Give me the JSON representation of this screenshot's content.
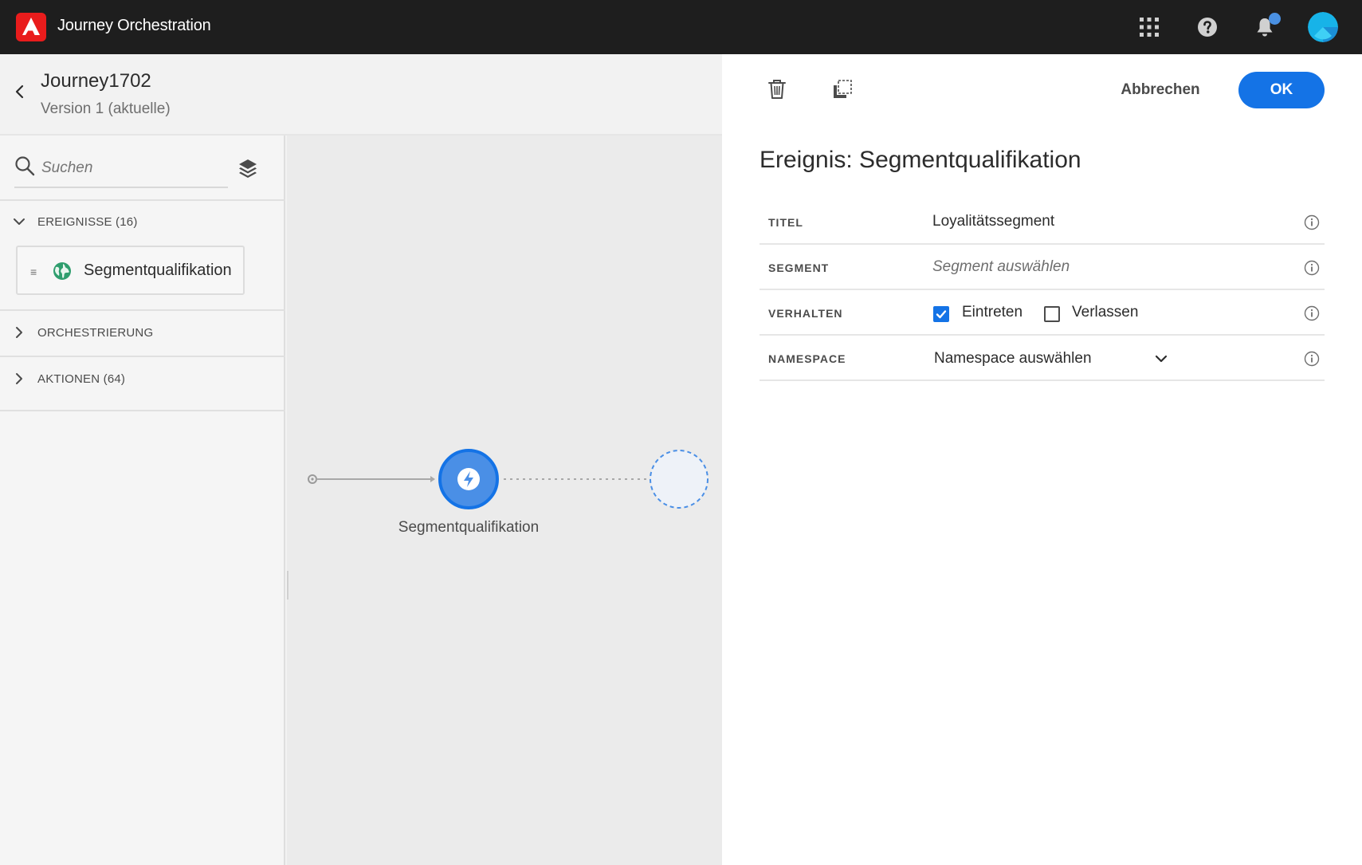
{
  "app": {
    "title": "Journey Orchestration"
  },
  "journey": {
    "title": "Journey1702",
    "version": "Version 1 (aktuelle)"
  },
  "sidebar": {
    "search_placeholder": "Suchen",
    "categories": [
      {
        "label": "EREIGNISSE (16)",
        "expanded": true
      },
      {
        "label": "ORCHESTRIERUNG",
        "expanded": false
      },
      {
        "label": "AKTIONEN (64)",
        "expanded": false
      }
    ],
    "event_item": {
      "label": "Segmentqualifikation",
      "icon": "globe-icon"
    }
  },
  "canvas": {
    "node_label": "Segmentqualifikation"
  },
  "panel": {
    "cancel_label": "Abbrechen",
    "ok_label": "OK",
    "title": "Ereignis: Segmentqualifikation",
    "rows": {
      "titel": {
        "label": "TITEL",
        "value": "Loyalitätssegment"
      },
      "segment": {
        "label": "SEGMENT",
        "placeholder": "Segment auswählen"
      },
      "verhalten": {
        "label": "VERHALTEN",
        "enter_label": "Eintreten",
        "enter_checked": true,
        "exit_label": "Verlassen",
        "exit_checked": false
      },
      "namespace": {
        "label": "NAMESPACE",
        "value": "Namespace auswählen"
      }
    }
  },
  "colors": {
    "topbar": "#1e1e1e",
    "accent": "#1473e6",
    "adobe_red": "#e91c1c",
    "event_node": "#4a8fe6"
  }
}
